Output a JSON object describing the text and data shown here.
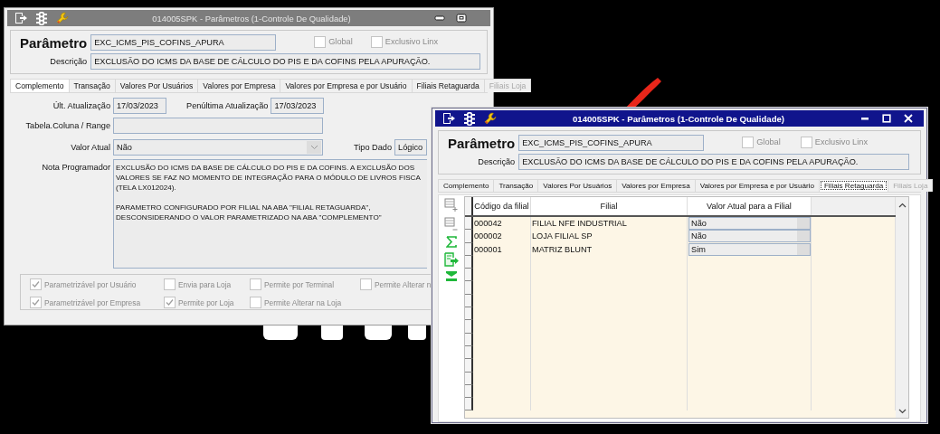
{
  "windows": [
    {
      "title": "014005SPK - Parâmetros (1-Controle De Qualidade)",
      "active": false,
      "parameter_label": "Parâmetro",
      "parameter": "EXC_ICMS_PIS_COFINS_APURA",
      "global": {
        "label": "Global",
        "checked": false,
        "disabled": true
      },
      "exclusive": {
        "label": "Exclusivo Linx",
        "checked": false,
        "disabled": true
      },
      "description_label": "Descrição",
      "description": "EXCLUSÃO DO ICMS DA BASE DE CÁLCULO DO PIS E DA COFINS PELA APURAÇÃO.",
      "tabs": [
        {
          "label": "Complemento",
          "selected": true,
          "disabled": false
        },
        {
          "label": "Transação",
          "selected": false,
          "disabled": false
        },
        {
          "label": "Valores Por Usuários",
          "selected": false,
          "disabled": false
        },
        {
          "label": "Valores por Empresa",
          "selected": false,
          "disabled": false
        },
        {
          "label": "Valores por Empresa e por Usuário",
          "selected": false,
          "disabled": false
        },
        {
          "label": "Filiais Retaguarda",
          "selected": false,
          "disabled": false
        },
        {
          "label": "Filiais Loja",
          "selected": false,
          "disabled": true
        }
      ],
      "body": {
        "kind": "complement",
        "last_update": {
          "label": "Últ. Atualização",
          "value": "17/03/2023"
        },
        "prev_update": {
          "label": "Penúltima Atualização",
          "value": "17/03/2023"
        },
        "table_column": {
          "label": "Tabela.Coluna / Range"
        },
        "current_value": {
          "label": "Valor Atual",
          "value": "Não"
        },
        "data_type": {
          "label": "Tipo Dado",
          "value": "Lógico"
        },
        "note": {
          "label": "Nota Programador",
          "paragraphs": [
            [
              "EXCLUSÃO DO ICMS DA BASE DE CÁLCULO DO PIS E DA COFINS. A EXCLUSÃO DOS",
              "VALORES SE FAZ NO MOMENTO DE INTEGRAÇÃO PARA O MÓDULO DE LIVROS FISCA",
              "(TELA LX012024)."
            ],
            [
              "PARAMETRO CONFIGURADO POR FILIAL NA ABA \"FILIAL RETAGUARDA\",",
              "DESCONSIDERANDO O VALOR PARAMETRIZADO NA ABA \"COMPLEMENTO\""
            ]
          ]
        },
        "options": [
          {
            "label": "Parametrizável por Usuário",
            "checked": true,
            "disabled": true
          },
          {
            "label": "Envia para Loja",
            "checked": false,
            "disabled": true
          },
          {
            "label": "Permite por Terminal",
            "checked": false,
            "disabled": true
          },
          {
            "label": "Permite Alterar n",
            "checked": false,
            "disabled": true
          },
          {
            "label": "Parametrizável por Empresa",
            "checked": true,
            "disabled": true
          },
          {
            "label": "Permite por Loja",
            "checked": true,
            "disabled": true
          },
          {
            "label": "Permite Alterar na Loja",
            "checked": false,
            "disabled": true
          }
        ]
      }
    },
    {
      "title": "014005SPK - Parâmetros (1-Controle De Qualidade)",
      "active": true,
      "parameter_label": "Parâmetro",
      "parameter": "EXC_ICMS_PIS_COFINS_APURA",
      "global": {
        "label": "Global",
        "checked": false,
        "disabled": true
      },
      "exclusive": {
        "label": "Exclusivo Linx",
        "checked": false,
        "disabled": true
      },
      "description_label": "Descrição",
      "description": "EXCLUSÃO DO ICMS DA BASE DE CÁLCULO DO PIS E DA COFINS PELA APURAÇÃO.",
      "tabs": [
        {
          "label": "Complemento",
          "selected": false,
          "disabled": false
        },
        {
          "label": "Transação",
          "selected": false,
          "disabled": false
        },
        {
          "label": "Valores Por Usuários",
          "selected": false,
          "disabled": false
        },
        {
          "label": "Valores por Empresa",
          "selected": false,
          "disabled": false
        },
        {
          "label": "Valores por Empresa e por Usuário",
          "selected": false,
          "disabled": false
        },
        {
          "label": "Filiais Retaguarda",
          "selected": true,
          "disabled": false
        },
        {
          "label": "Filiais Loja",
          "selected": false,
          "disabled": true
        }
      ],
      "body": {
        "kind": "grid",
        "columns": [
          "Código da filial",
          "Filial",
          "Valor Atual para a Filial"
        ],
        "rows": [
          {
            "code": "000042",
            "name": "FILIAL NFE INDUSTRIAL",
            "value": "Não"
          },
          {
            "code": "000002",
            "name": "LOJA FILIAL SP",
            "value": "Não"
          },
          {
            "code": "000001",
            "name": "MATRIZ BLUNT",
            "value": "Sim"
          }
        ]
      }
    }
  ]
}
